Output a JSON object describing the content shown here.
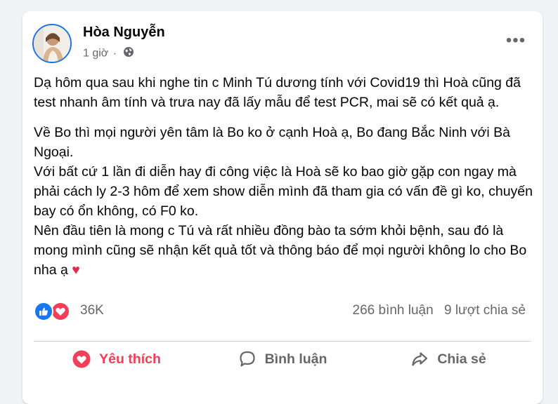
{
  "post": {
    "author": "Hòa Nguyễn",
    "time": "1 giờ",
    "separator": "·",
    "privacy_icon": "globe-icon",
    "more_icon": "more-options-icon",
    "more_label": "•••",
    "paragraphs": [
      "Dạ hôm qua sau khi nghe tin c Minh Tú dương tính với Covid19 thì Hoà cũng đã test nhanh âm tính và trưa nay đã lấy mẫu để test PCR, mai sẽ có kết quả ạ.",
      "Về Bo thì mọi người yên tâm là Bo ko ở cạnh Hoà ạ, Bo đang Bắc Ninh với Bà Ngoại.",
      "Với bất cứ 1 lần đi diễn hay đi công việc là Hoà sẽ ko bao giờ gặp con ngay mà phải cách ly 2-3 hôm để xem show diễn mình đã tham gia có vấn đề gì ko, chuyến bay có ổn không, có F0 ko.",
      "Nên đầu tiên là mong c Tú và rất nhiều đồng bào ta sớm khỏi bệnh, sau đó là mong mình cũng sẽ nhận kết quả tốt và thông báo để mọi người không lo cho Bo nha ạ "
    ],
    "emoji": "♥"
  },
  "reactions": {
    "icons": [
      "like-reaction-icon",
      "love-reaction-icon"
    ],
    "count": "36K",
    "comments": "266 bình luận",
    "shares": "9 lượt chia sẻ"
  },
  "actions": {
    "like": "Yêu thích",
    "comment": "Bình luận",
    "share": "Chia sẻ"
  },
  "colors": {
    "background": "#f0f2f5",
    "card": "#ffffff",
    "love": "#f33e58",
    "like": "#1877f2",
    "secondary_text": "#65676b",
    "avatar_ring": "#1b74e4"
  }
}
